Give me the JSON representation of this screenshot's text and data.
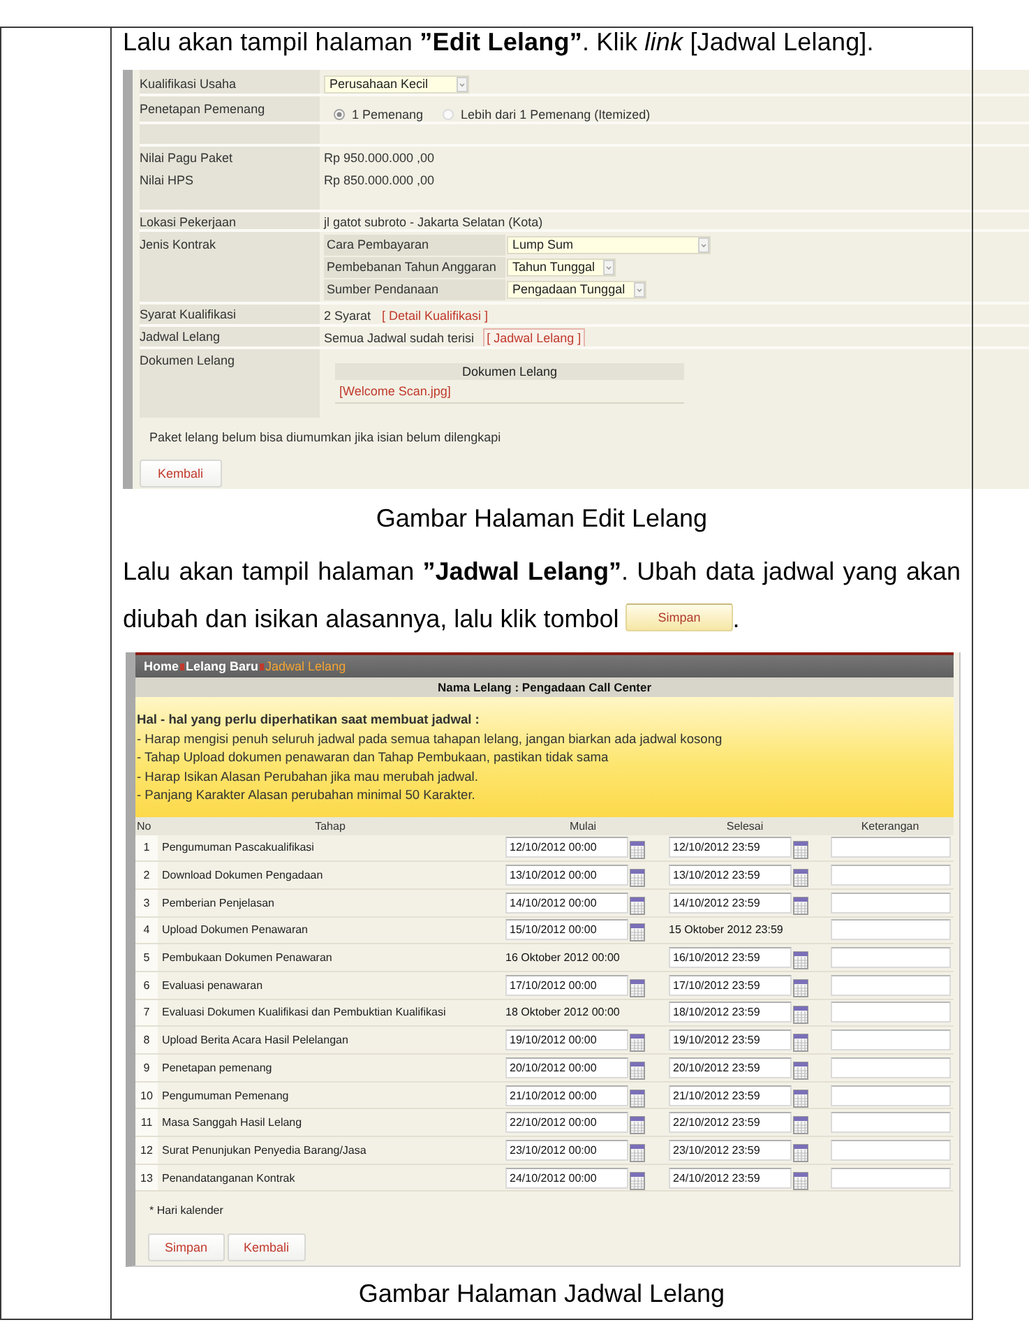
{
  "intro": "Lalu akan tampil halaman **”Edit Lelang”**. Klik *link* [Jadwal Lelang].",
  "edit_lelang": {
    "fields": [
      {
        "kind": "select",
        "label": "Kualifikasi Usaha",
        "value": "Perusahaan Kecil"
      },
      {
        "kind": "radio",
        "label": "Penetapan Pemenang",
        "options": [
          {
            "label": "1 Pemenang",
            "selected": true
          },
          {
            "label": "Lebih dari 1 Pemenang (Itemized)",
            "selected": false
          }
        ]
      },
      {
        "kind": "blank"
      },
      {
        "kind": "values",
        "items": [
          {
            "label": "Nilai Pagu Paket",
            "value": "Rp 950.000.000 ,00"
          },
          {
            "label": "Nilai HPS",
            "value": "Rp 850.000.000 ,00"
          }
        ]
      },
      {
        "kind": "text",
        "label": "Lokasi Pekerjaan",
        "value": "jl gatot subroto - Jakarta Selatan (Kota)"
      },
      {
        "kind": "nested",
        "label": "Jenis Kontrak",
        "rows": [
          {
            "label": "Cara Pembayaran",
            "value": "Lump Sum"
          },
          {
            "label": "Pembebanan Tahun Anggaran",
            "value": "Tahun Tunggal"
          },
          {
            "label": "Sumber Pendanaan",
            "value": "Pengadaan Tunggal"
          }
        ]
      },
      {
        "kind": "link",
        "label": "Syarat Kualifikasi",
        "value": "2 Syarat",
        "link": "[ Detail Kualifikasi ]",
        "highlighted": false
      },
      {
        "kind": "link",
        "label": "Jadwal Lelang",
        "value": "Semua Jadwal sudah terisi",
        "link": "[ Jadwal Lelang ]",
        "highlighted": true
      },
      {
        "kind": "documents",
        "label": "Dokumen Lelang",
        "header": "Dokumen Lelang",
        "files": [
          "[Welcome Scan.jpg]"
        ]
      }
    ],
    "notice": "Paket lelang belum bisa diumumkan jika isian belum dilengkapi",
    "back_button": "Kembali"
  },
  "caption_edit": "Gambar Halaman Edit Lelang",
  "instruction": {
    "text": "Lalu akan tampil halaman **”Jadwal Lelang”**. Ubah data jadwal yang akan diubah dan isikan alasannya, lalu klik tombol",
    "button": "Simpan",
    "end": "."
  },
  "jadwal_lelang": {
    "breadcrumb": [
      {
        "label": "Home",
        "selected": false
      },
      {
        "label": "Lelang Baru",
        "selected": false
      },
      {
        "label": "Jadwal Lelang",
        "selected": true
      }
    ],
    "title": "Nama Lelang : Pengadaan Call Center",
    "notes_title": "Hal - hal yang perlu diperhatikan saat membuat jadwal :",
    "notes": [
      "- Harap mengisi penuh seluruh jadwal pada semua tahapan lelang, jangan biarkan ada jadwal kosong",
      "- Tahap Upload dokumen penawaran dan Tahap Pembukaan, pastikan tidak sama",
      "- Harap Isikan Alasan Perubahan jika mau merubah jadwal.",
      "- Panjang Karakter Alasan perubahan minimal 50 Karakter."
    ],
    "columns": [
      "No",
      "Tahap",
      "Mulai",
      "Selesai",
      "Keterangan"
    ],
    "rows": [
      {
        "no": "1",
        "tahap": "Pengumuman Pascakualifikasi",
        "mulai": {
          "kind": "input",
          "value": "12/10/2012 00:00"
        },
        "selesai": {
          "kind": "input",
          "value": "12/10/2012 23:59"
        }
      },
      {
        "no": "2",
        "tahap": "Download Dokumen Pengadaan",
        "mulai": {
          "kind": "input",
          "value": "13/10/2012 00:00"
        },
        "selesai": {
          "kind": "input",
          "value": "13/10/2012 23:59"
        }
      },
      {
        "no": "3",
        "tahap": "Pemberian Penjelasan",
        "mulai": {
          "kind": "input",
          "value": "14/10/2012 00:00"
        },
        "selesai": {
          "kind": "input",
          "value": "14/10/2012 23:59"
        }
      },
      {
        "no": "4",
        "tahap": "Upload Dokumen Penawaran",
        "mulai": {
          "kind": "input",
          "value": "15/10/2012 00:00"
        },
        "selesai": {
          "kind": "text",
          "value": "15 Oktober 2012 23:59"
        }
      },
      {
        "no": "5",
        "tahap": "Pembukaan Dokumen Penawaran",
        "mulai": {
          "kind": "text",
          "value": "16 Oktober 2012 00:00"
        },
        "selesai": {
          "kind": "input",
          "value": "16/10/2012 23:59"
        }
      },
      {
        "no": "6",
        "tahap": "Evaluasi penawaran",
        "mulai": {
          "kind": "input",
          "value": "17/10/2012 00:00"
        },
        "selesai": {
          "kind": "input",
          "value": "17/10/2012 23:59"
        }
      },
      {
        "no": "7",
        "tahap": "Evaluasi Dokumen Kualifikasi dan Pembuktian Kualifikasi",
        "mulai": {
          "kind": "text",
          "value": "18 Oktober 2012 00:00"
        },
        "selesai": {
          "kind": "input",
          "value": "18/10/2012 23:59"
        }
      },
      {
        "no": "8",
        "tahap": "Upload Berita Acara Hasil Pelelangan",
        "mulai": {
          "kind": "input",
          "value": "19/10/2012 00:00"
        },
        "selesai": {
          "kind": "input",
          "value": "19/10/2012 23:59"
        }
      },
      {
        "no": "9",
        "tahap": "Penetapan pemenang",
        "mulai": {
          "kind": "input",
          "value": "20/10/2012 00:00"
        },
        "selesai": {
          "kind": "input",
          "value": "20/10/2012 23:59"
        }
      },
      {
        "no": "10",
        "tahap": "Pengumuman Pemenang",
        "mulai": {
          "kind": "input",
          "value": "21/10/2012 00:00"
        },
        "selesai": {
          "kind": "input",
          "value": "21/10/2012 23:59"
        }
      },
      {
        "no": "11",
        "tahap": "Masa Sanggah Hasil Lelang",
        "mulai": {
          "kind": "input",
          "value": "22/10/2012 00:00"
        },
        "selesai": {
          "kind": "input",
          "value": "22/10/2012 23:59"
        }
      },
      {
        "no": "12",
        "tahap": "Surat Penunjukan Penyedia Barang/Jasa",
        "mulai": {
          "kind": "input",
          "value": "23/10/2012 00:00"
        },
        "selesai": {
          "kind": "input",
          "value": "23/10/2012 23:59"
        }
      },
      {
        "no": "13",
        "tahap": "Penandatanganan Kontrak",
        "mulai": {
          "kind": "input",
          "value": "24/10/2012 00:00"
        },
        "selesai": {
          "kind": "input",
          "value": "24/10/2012 23:59"
        }
      }
    ],
    "footnote": "* Hari kalender",
    "save_button": "Simpan",
    "back_button": "Kembali"
  },
  "caption_jadwal": "Gambar Halaman Jadwal Lelang"
}
